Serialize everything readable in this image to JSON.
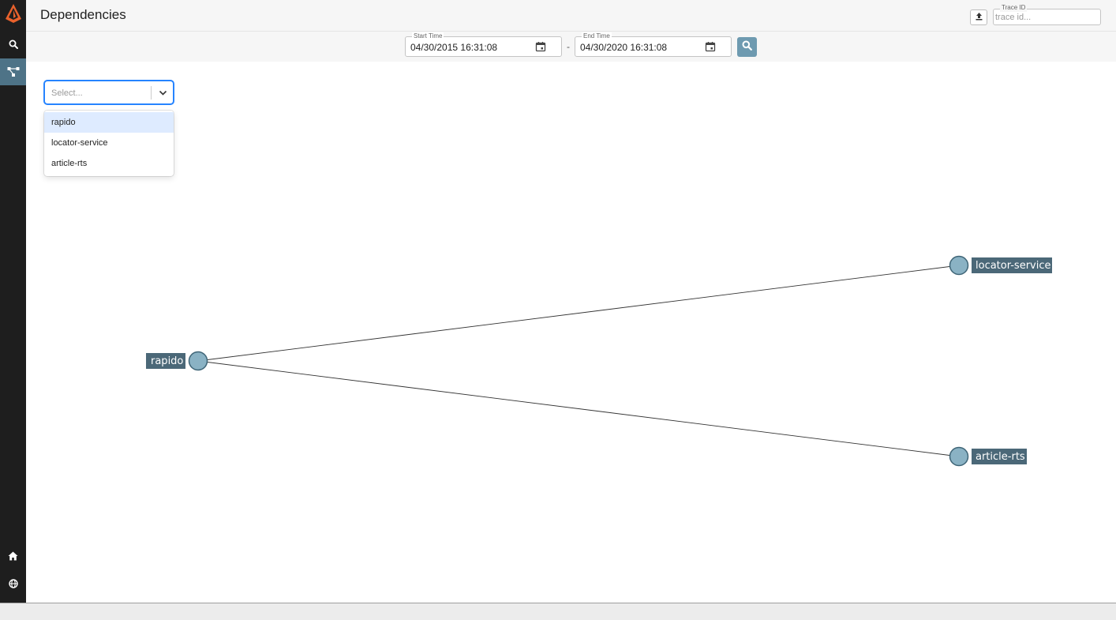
{
  "header": {
    "title": "Dependencies",
    "trace": {
      "legend": "Trace ID",
      "placeholder": "trace id..."
    }
  },
  "timebar": {
    "start": {
      "legend": "Start Time",
      "value": "04/30/2015 16:31:08"
    },
    "separator": "-",
    "end": {
      "legend": "End Time",
      "value": "04/30/2020 16:31:08"
    }
  },
  "select": {
    "placeholder": "Select...",
    "options": [
      {
        "label": "rapido"
      },
      {
        "label": "locator-service"
      },
      {
        "label": "article-rts"
      }
    ]
  },
  "graph": {
    "nodes": [
      {
        "id": "rapido",
        "label": "rapido"
      },
      {
        "id": "locator-service",
        "label": "locator-service"
      },
      {
        "id": "article-rts",
        "label": "article-rts"
      }
    ],
    "edges": [
      {
        "from": "rapido",
        "to": "locator-service"
      },
      {
        "from": "rapido",
        "to": "article-rts"
      }
    ]
  },
  "colors": {
    "sidebar": "#1e1e1e",
    "accent": "#6e9ab0",
    "active_nav": "#4e7387",
    "brand": "#e8612c",
    "node_fill": "#8ab2c4",
    "label_bg": "#4b6878"
  },
  "icons": {
    "logo": "zipkin-logo-icon",
    "nav": [
      "search-icon",
      "dependencies-icon"
    ],
    "bottom_nav": [
      "home-icon",
      "globe-icon"
    ]
  }
}
